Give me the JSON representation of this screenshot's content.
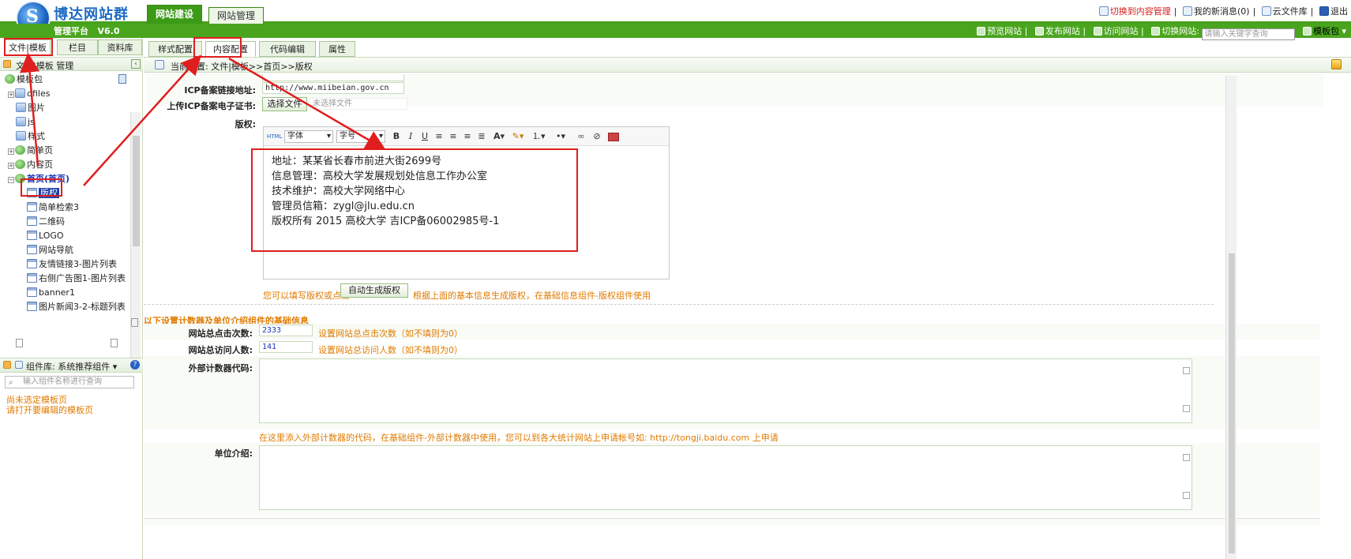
{
  "header": {
    "brand": "博达网站群",
    "logo_letter": "S",
    "platform": "管理平台",
    "version": "V6.0",
    "tabs": [
      "网站建设",
      "网站管理"
    ],
    "links": [
      "切换到内容管理",
      "我的新消息(0)",
      "云文件库",
      "退出"
    ],
    "link_separators": "|"
  },
  "toolbar": {
    "links": [
      "预览网站",
      "发布网站",
      "访问网站",
      "切换网站:"
    ],
    "search_placeholder": "请输入关键字查询",
    "template_pack": "模板包"
  },
  "left": {
    "tabs": [
      "文件|模板",
      "栏目",
      "资料库"
    ],
    "header": "文件|模板 管理",
    "tree": [
      {
        "label": "模板包"
      },
      {
        "label": "dfiles"
      },
      {
        "label": "图片"
      },
      {
        "label": "js"
      },
      {
        "label": "样式"
      },
      {
        "label": "简单页"
      },
      {
        "label": "内容页"
      },
      {
        "label": "首页(首页)"
      },
      {
        "label": "版权"
      },
      {
        "label": "简单检索3"
      },
      {
        "label": "二维码"
      },
      {
        "label": "LOGO"
      },
      {
        "label": "网站导航"
      },
      {
        "label": "友情链接3-图片列表"
      },
      {
        "label": "右侧广告图1-图片列表"
      },
      {
        "label": "banner1"
      },
      {
        "label": "图片新闻3-2-标题列表"
      }
    ],
    "component_lib": "组件库: 系统推荐组件",
    "component_search_placeholder": "输入组件名称进行查询",
    "message_line1": "尚未选定模板页",
    "message_line2": "请打开要编辑的模板页"
  },
  "right": {
    "tabs": [
      "样式配置",
      "内容配置",
      "代码编辑",
      "属性"
    ],
    "breadcrumb": "当前位置: 文件|模板>>首页>>版权",
    "fields": {
      "icp_link_label": "ICP备案链接地址:",
      "icp_link_value": "http://www.miibeian.gov.cn",
      "icp_cert_label": "上传ICP备案电子证书:",
      "choose_file": "选择文件",
      "no_file": "未选择文件",
      "copyright_label": "版权:"
    },
    "editor": {
      "font": "字体",
      "size": "字号",
      "lines": [
        "地址：某某省长春市前进大街2699号",
        "信息管理：高校大学发展规划处信息工作办公室",
        "技术维护：高校大学网络中心",
        "管理员信箱：zygl@jlu.edu.cn",
        "版权所有 2015 高校大学 吉ICP备06002985号-1"
      ]
    },
    "copyright_hint_before": "您可以填写版权或点击",
    "auto_gen_button": "自动生成版权",
    "copyright_hint_after": "根据上面的基本信息生成版权，在基础信息组件-版权组件使用",
    "section_title": "以下设置计数器及单位介绍组件的基础信息",
    "click_label": "网站总点击次数:",
    "click_value": "2333",
    "click_hint": "设置网站总点击次数（如不填则为0）",
    "visit_label": "网站总访问人数:",
    "visit_value": "141",
    "visit_hint": "设置网站总访问人数（如不填则为0）",
    "counter_label": "外部计数器代码:",
    "counter_hint": "在这里添入外部计数器的代码，在基础组件-外部计数器中使用，您可以到各大统计网站上申请帐号如: http://tongji.baidu.com 上申请",
    "unit_label": "单位介绍:"
  },
  "colors": {
    "brand_blue": "#1d6bc4",
    "green": "#4aa51e",
    "hint_orange": "#e07b00",
    "annotation_red": "#e01e1e"
  }
}
